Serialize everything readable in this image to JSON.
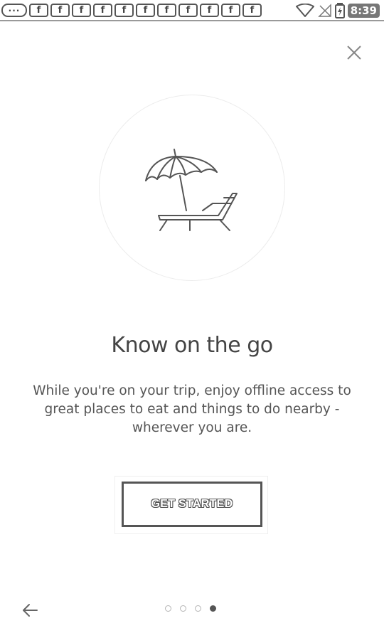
{
  "status_bar": {
    "time": "8:39",
    "notification_icons": [
      "more-icon",
      "facebook-icon",
      "facebook-icon",
      "facebook-icon",
      "facebook-icon",
      "facebook-icon",
      "facebook-icon",
      "facebook-icon",
      "facebook-icon",
      "facebook-icon",
      "facebook-icon",
      "facebook-icon"
    ],
    "dots_glyph": "···",
    "fb_glyph": "f"
  },
  "onboarding": {
    "title": "Know on the go",
    "description": "While you're on your trip, enjoy offline access to great places to eat and things to do nearby - wherever you are.",
    "cta_label": "GET STARTED",
    "illustration": "beach-umbrella-lounger-icon"
  },
  "pager": {
    "total_pages": 4,
    "current_page": 4
  },
  "colors": {
    "text": "#444444",
    "border": "#555555",
    "inactive_dot": "#b4b4b4"
  }
}
